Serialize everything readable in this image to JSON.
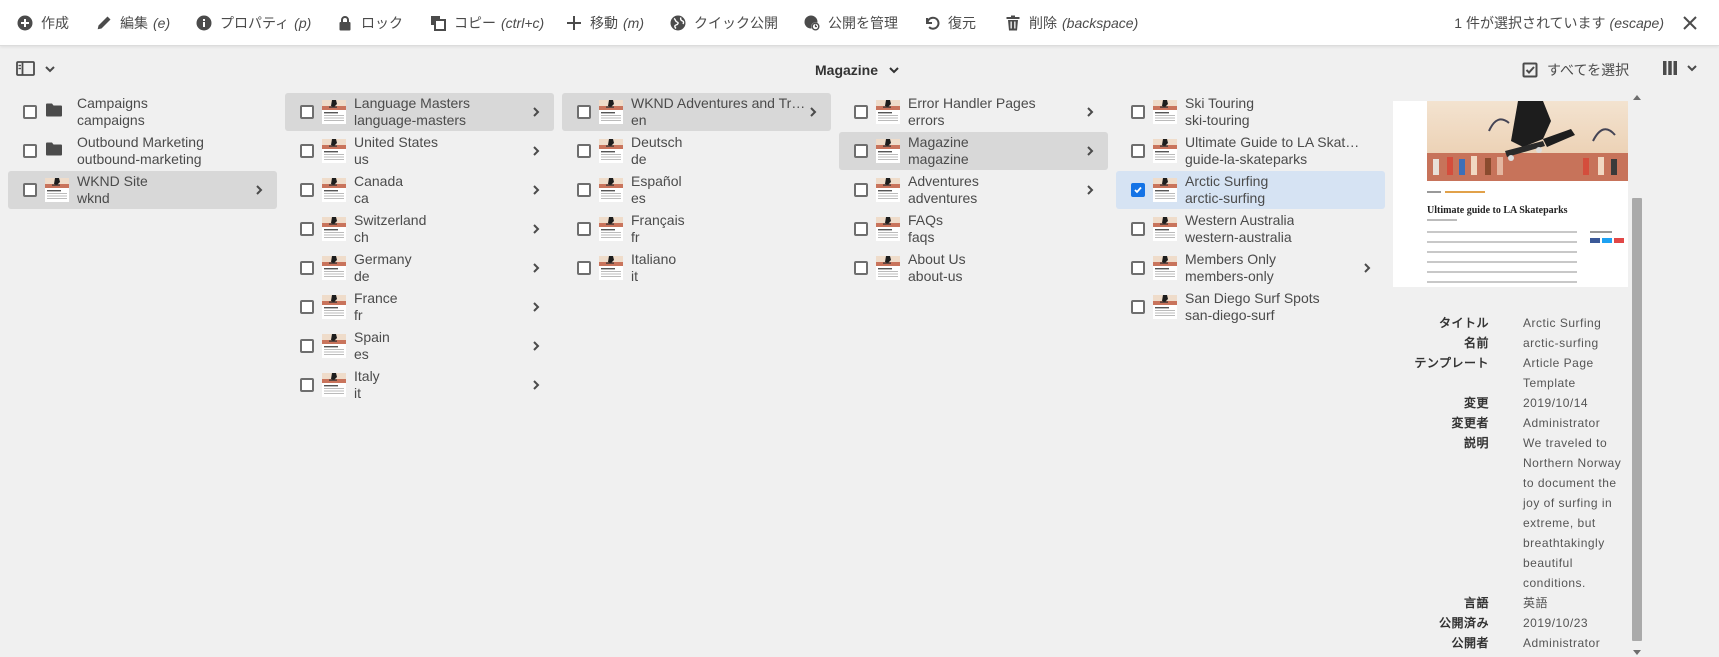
{
  "actionbar": {
    "create": "作成",
    "edit": "編集",
    "edit_key": "(e)",
    "properties": "プロパティ",
    "properties_key": "(p)",
    "lock": "ロック",
    "copy": "コピー",
    "copy_key": "(ctrl+c)",
    "move": "移動",
    "move_key": "(m)",
    "quick_publish": "クイック公開",
    "manage_publication": "公開を管理",
    "restore": "復元",
    "delete": "削除",
    "delete_key": "(backspace)",
    "selection_count": "1 件が選択されています",
    "selection_key": "(escape)"
  },
  "header": {
    "title": "Magazine",
    "select_all": "すべてを選択"
  },
  "columns": [
    {
      "items": [
        {
          "title": "Campaigns",
          "name": "campaigns",
          "icon": "folder-icon"
        },
        {
          "title": "Outbound Marketing",
          "name": "outbound-marketing",
          "icon": "folder-icon"
        },
        {
          "title": "WKND Site",
          "name": "wknd",
          "icon": "page-thumbnail",
          "state": "active",
          "has_children": true
        }
      ]
    },
    {
      "items": [
        {
          "title": "Language Masters",
          "name": "language-masters",
          "state": "active",
          "has_children": true
        },
        {
          "title": "United States",
          "name": "us",
          "has_children": true
        },
        {
          "title": "Canada",
          "name": "ca",
          "has_children": true
        },
        {
          "title": "Switzerland",
          "name": "ch",
          "has_children": true
        },
        {
          "title": "Germany",
          "name": "de",
          "has_children": true
        },
        {
          "title": "France",
          "name": "fr",
          "has_children": true
        },
        {
          "title": "Spain",
          "name": "es",
          "has_children": true
        },
        {
          "title": "Italy",
          "name": "it",
          "has_children": true
        }
      ]
    },
    {
      "items": [
        {
          "title": "WKND Adventures and Tr…",
          "name": "en",
          "state": "active",
          "has_children": true
        },
        {
          "title": "Deutsch",
          "name": "de"
        },
        {
          "title": "Español",
          "name": "es"
        },
        {
          "title": "Français",
          "name": "fr"
        },
        {
          "title": "Italiano",
          "name": "it"
        }
      ]
    },
    {
      "items": [
        {
          "title": "Error Handler Pages",
          "name": "errors",
          "has_children": true
        },
        {
          "title": "Magazine",
          "name": "magazine",
          "state": "active",
          "has_children": true
        },
        {
          "title": "Adventures",
          "name": "adventures",
          "has_children": true
        },
        {
          "title": "FAQs",
          "name": "faqs"
        },
        {
          "title": "About Us",
          "name": "about-us"
        }
      ]
    },
    {
      "items": [
        {
          "title": "Ski Touring",
          "name": "ski-touring"
        },
        {
          "title": "Ultimate Guide to LA Skat…",
          "name": "guide-la-skateparks"
        },
        {
          "title": "Arctic Surfing",
          "name": "arctic-surfing",
          "state": "selected",
          "checked": true
        },
        {
          "title": "Western Australia",
          "name": "western-australia"
        },
        {
          "title": "Members Only",
          "name": "members-only",
          "has_children": true
        },
        {
          "title": "San Diego Surf Spots",
          "name": "san-diego-surf"
        }
      ]
    }
  ],
  "preview": {
    "image_heading": "Ultimate guide to LA Skateparks",
    "meta": [
      {
        "key": "タイトル",
        "value": "Arctic Surfing"
      },
      {
        "key": "名前",
        "value": "arctic-surfing"
      },
      {
        "key": "テンプレート",
        "value": "Article Page Template"
      },
      {
        "key": "変更",
        "value": "2019/10/14"
      },
      {
        "key": "変更者",
        "value": "Administrator"
      },
      {
        "key": "説明",
        "value": "We traveled to Northern Norway to document the joy of surfing in extreme, but breathtakingly beautiful conditions."
      },
      {
        "key": "言語",
        "value": "英語"
      },
      {
        "key": "公開済み",
        "value": "2019/10/23"
      },
      {
        "key": "公開者",
        "value": "Administrator"
      }
    ]
  },
  "colors": {
    "accent": "#1473e6",
    "active_row": "#d8d8d8",
    "selected_row": "#d6e3f3",
    "background": "#f0f0f0"
  }
}
